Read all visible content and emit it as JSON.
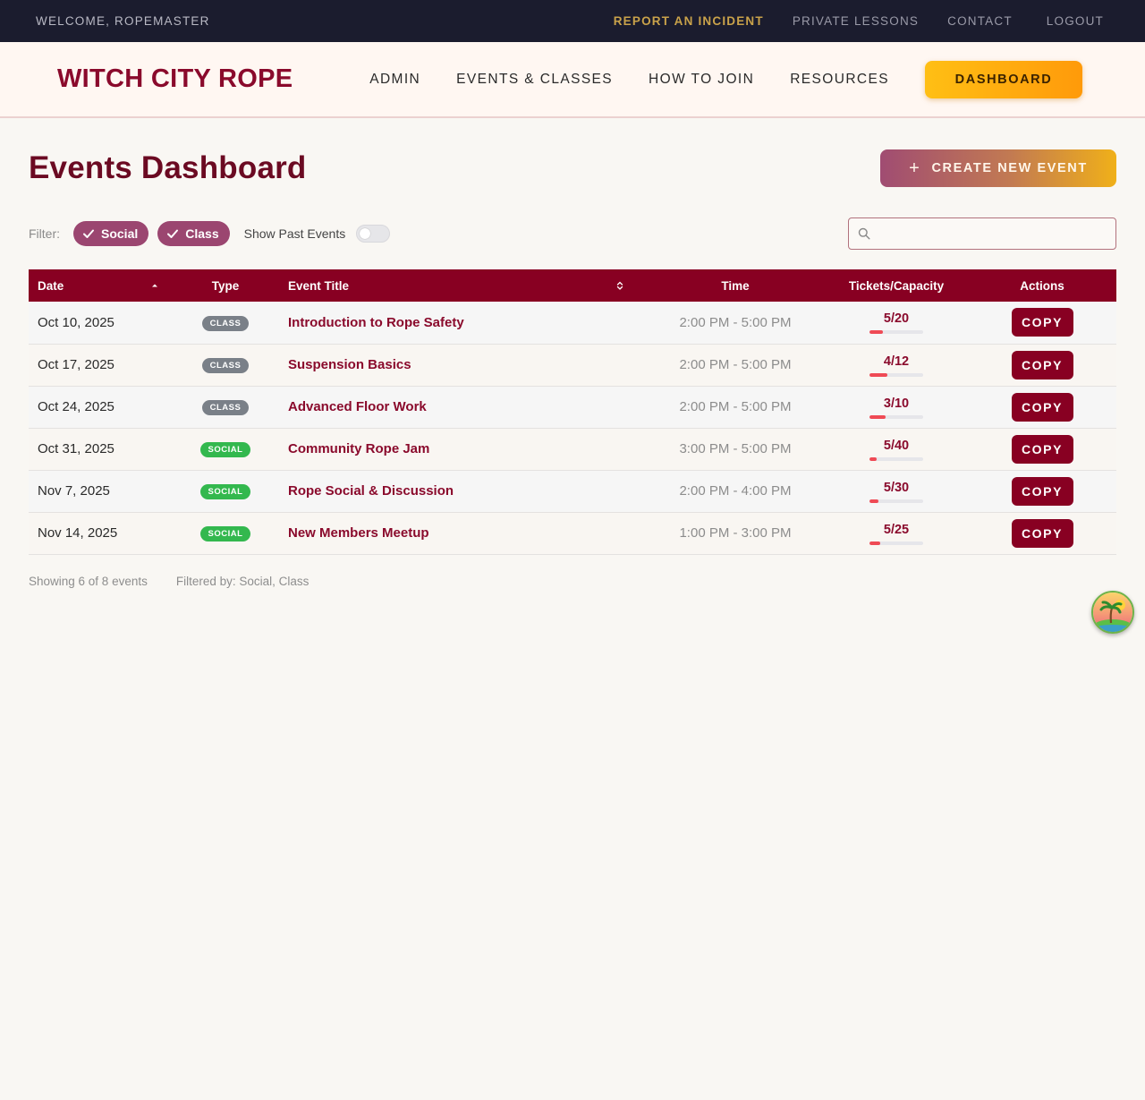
{
  "utility_bar": {
    "welcome": "WELCOME, ROPEMASTER",
    "links": [
      "REPORT AN INCIDENT",
      "PRIVATE LESSONS",
      "CONTACT",
      "LOGOUT"
    ]
  },
  "nav": {
    "brand": "WITCH CITY ROPE",
    "items": [
      "ADMIN",
      "EVENTS & CLASSES",
      "HOW TO JOIN",
      "RESOURCES"
    ],
    "dashboard_label": "DASHBOARD"
  },
  "page": {
    "title": "Events Dashboard",
    "create_label": "CREATE NEW EVENT"
  },
  "filters": {
    "label": "Filter:",
    "chips": [
      "Social",
      "Class"
    ],
    "show_past_label": "Show Past Events",
    "show_past_enabled": false,
    "search_placeholder": "",
    "search_value": ""
  },
  "table": {
    "columns": [
      "Date",
      "Type",
      "Event Title",
      "Time",
      "Tickets/Capacity",
      "Actions"
    ],
    "rows": [
      {
        "date": "Oct 10, 2025",
        "type": "CLASS",
        "title": "Introduction to Rope Safety",
        "time": "2:00 PM - 5:00 PM",
        "tickets": "5/20",
        "sold": 5,
        "capacity": 20,
        "action": "COPY"
      },
      {
        "date": "Oct 17, 2025",
        "type": "CLASS",
        "title": "Suspension Basics",
        "time": "2:00 PM - 5:00 PM",
        "tickets": "4/12",
        "sold": 4,
        "capacity": 12,
        "action": "COPY"
      },
      {
        "date": "Oct 24, 2025",
        "type": "CLASS",
        "title": "Advanced Floor Work",
        "time": "2:00 PM - 5:00 PM",
        "tickets": "3/10",
        "sold": 3,
        "capacity": 10,
        "action": "COPY"
      },
      {
        "date": "Oct 31, 2025",
        "type": "SOCIAL",
        "title": "Community Rope Jam",
        "time": "3:00 PM - 5:00 PM",
        "tickets": "5/40",
        "sold": 5,
        "capacity": 40,
        "action": "COPY"
      },
      {
        "date": "Nov 7, 2025",
        "type": "SOCIAL",
        "title": "Rope Social & Discussion",
        "time": "2:00 PM - 4:00 PM",
        "tickets": "5/30",
        "sold": 5,
        "capacity": 30,
        "action": "COPY"
      },
      {
        "date": "Nov 14, 2025",
        "type": "SOCIAL",
        "title": "New Members Meetup",
        "time": "1:00 PM - 3:00 PM",
        "tickets": "5/25",
        "sold": 5,
        "capacity": 25,
        "action": "COPY"
      }
    ]
  },
  "summary": {
    "showing": "Showing 6 of 8 events",
    "filtered_by": "Filtered by: Social, Class"
  },
  "colors": {
    "brand": "#880022",
    "accent_gold": "#ffbf14",
    "chip": "#9b4670",
    "social_badge": "#33b84e",
    "class_badge": "#7a8088",
    "capacity_fill": "#ef4a55"
  },
  "icons": {
    "chip_check": "check-icon",
    "create": "plus-icon",
    "search": "search-icon",
    "date_sort": "sort-ascending-icon",
    "title_sort": "sort-unsorted-icon",
    "floating": "tropical-island-icon"
  }
}
